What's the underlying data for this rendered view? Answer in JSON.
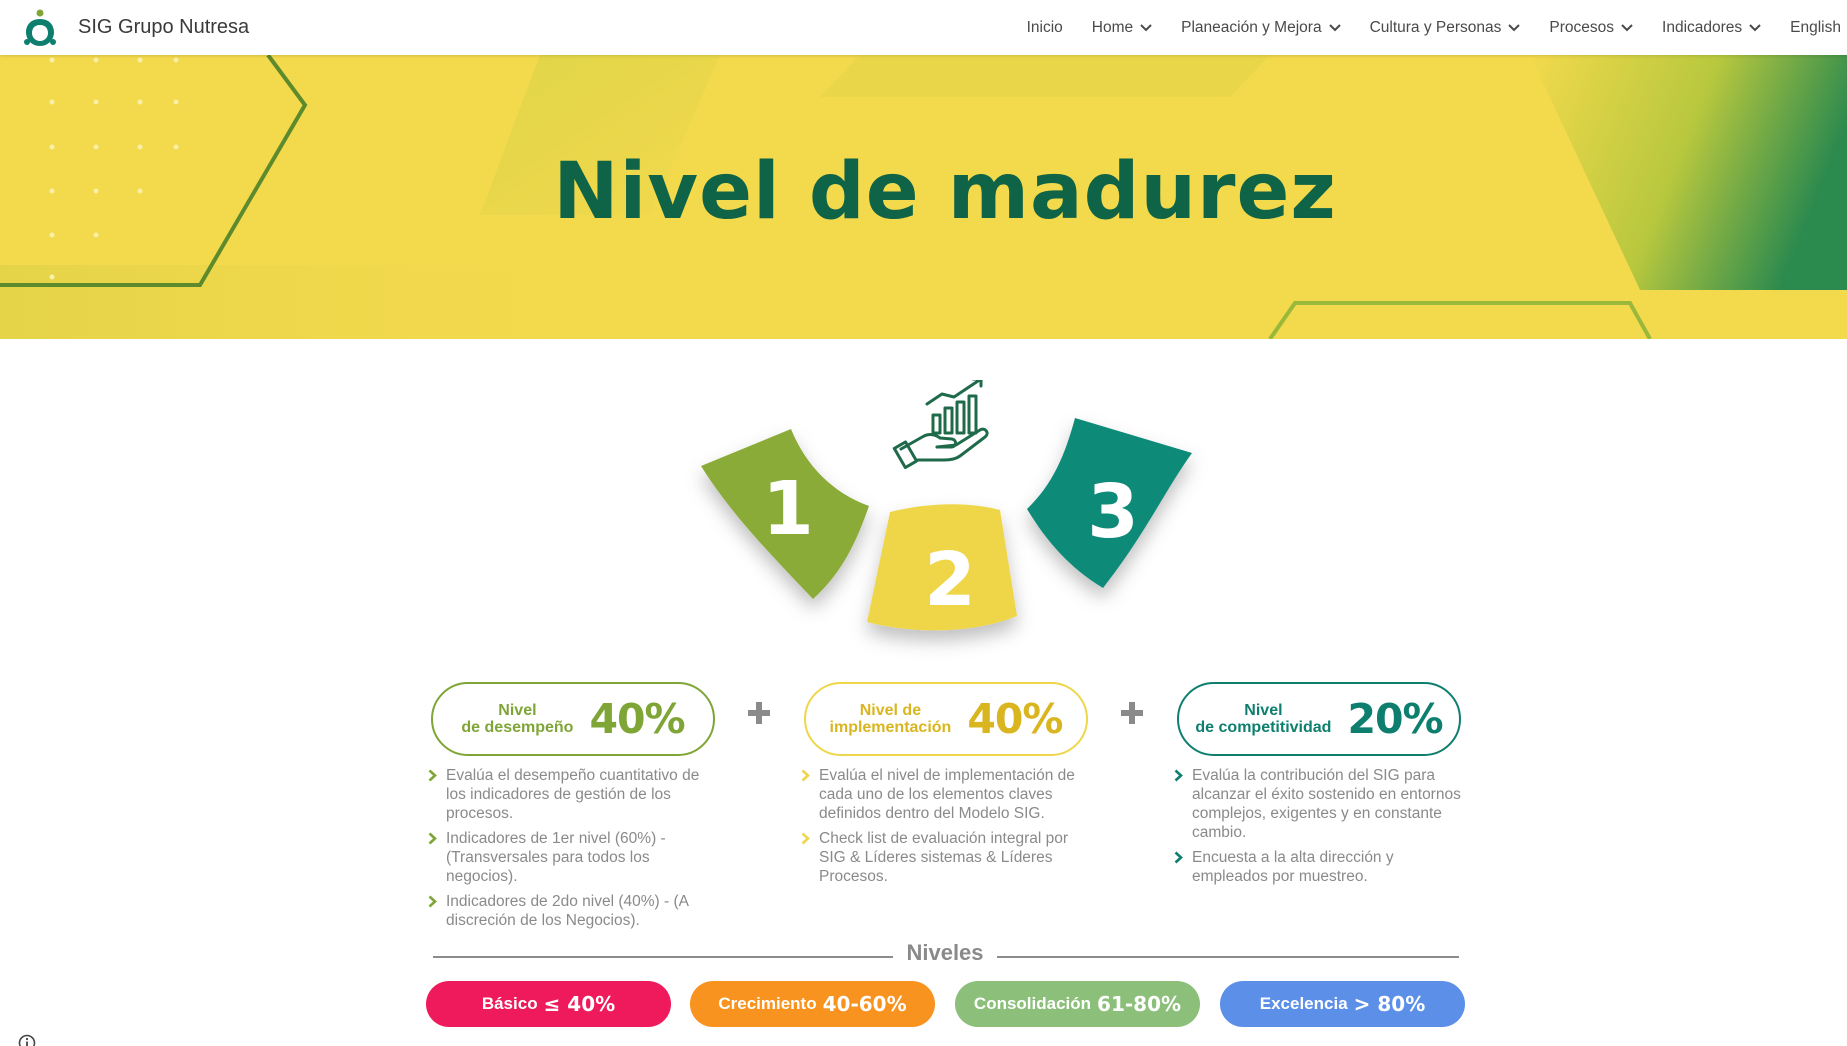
{
  "site": {
    "name": "SIG Grupo Nutresa"
  },
  "nav": {
    "items": [
      {
        "label": "Inicio",
        "has_menu": false
      },
      {
        "label": "Home",
        "has_menu": true
      },
      {
        "label": "Planeación y Mejora",
        "has_menu": true
      },
      {
        "label": "Cultura y Personas",
        "has_menu": true
      },
      {
        "label": "Procesos",
        "has_menu": true
      },
      {
        "label": "Indicadores",
        "has_menu": true
      },
      {
        "label": "English",
        "has_menu": false
      }
    ]
  },
  "banner": {
    "title": "Nivel de madurez"
  },
  "steps": {
    "one": "1",
    "two": "2",
    "three": "3"
  },
  "pillars": [
    {
      "label_line1": "Nivel",
      "label_line2": "de desempeño",
      "percent": "40%",
      "color": "#7fa536",
      "bullets": [
        "Evalúa el desempeño cuantitativo de los indicadores de gestión de los procesos.",
        "Indicadores de 1er nivel (60%) - (Transversales para todos los negocios).",
        "Indicadores de 2do nivel (40%) - (A discreción de los Negocios)."
      ]
    },
    {
      "label_line1": "Nivel de",
      "label_line2": "implementación",
      "percent": "40%",
      "color": "#d9b520",
      "bullets": [
        "Evalúa el nivel de implementación de cada uno de los elementos claves definidos dentro del Modelo SIG.",
        "Check list de evaluación integral por SIG & Líderes sistemas & Líderes Procesos."
      ]
    },
    {
      "label_line1": "Nivel",
      "label_line2": "de competitividad",
      "percent": "20%",
      "color": "#0e7f6e",
      "bullets": [
        "Evalúa la contribución del SIG para alcanzar el éxito sostenido en entornos complejos, exigentes y en constante cambio.",
        "Encuesta a la alta dirección y empleados por muestreo."
      ]
    }
  ],
  "niveles": {
    "title": "Niveles",
    "items": [
      {
        "name": "Básico",
        "range": "≤ 40%",
        "color": "#ee1a5b"
      },
      {
        "name": "Crecimiento",
        "range": "40-60%",
        "color": "#f7931e"
      },
      {
        "name": "Consolidación",
        "range": "61-80%",
        "color": "#8cc07a"
      },
      {
        "name": "Excelencia",
        "range": "> 80%",
        "color": "#5b8fe8"
      }
    ]
  },
  "icons": [
    "logo-icon",
    "chevron-down-icon",
    "growth-hand-icon",
    "plus-icon",
    "bullet-chevron-icon",
    "info-icon"
  ]
}
